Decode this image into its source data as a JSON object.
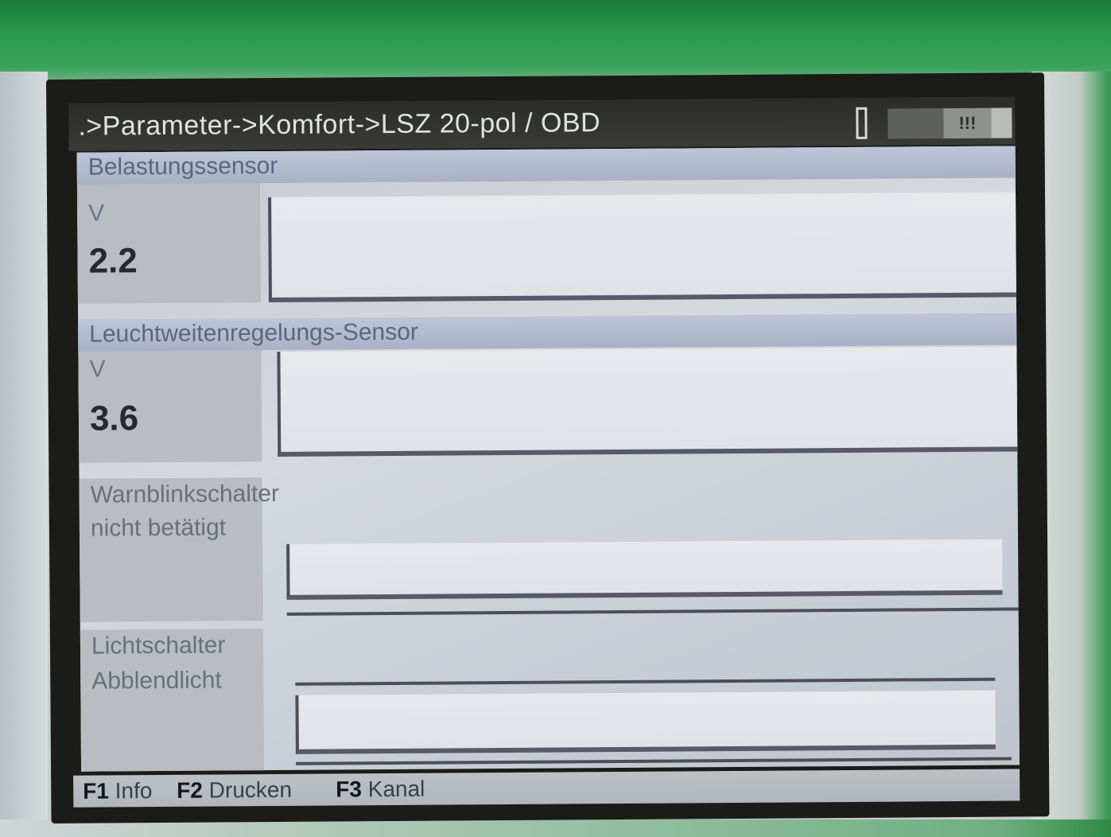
{
  "window": {
    "title": ".>Parameter->Komfort->LSZ 20-pol / OBD",
    "status_box": "!!!"
  },
  "panels": [
    {
      "title": "Belastungssensor",
      "unit": "V",
      "value": "2.2"
    },
    {
      "title": "Leuchtweitenregelungs-Sensor",
      "unit": "V",
      "value": "3.6"
    },
    {
      "title": "Warnblinkschalter",
      "state": "nicht betätigt"
    },
    {
      "title": "Lichtschalter",
      "state": "Abblendlicht"
    }
  ],
  "footer": {
    "keys": [
      {
        "key": "F1",
        "label": "Info"
      },
      {
        "key": "F2",
        "label": "Drucken"
      },
      {
        "key": "F3",
        "label": "Kanal"
      }
    ]
  },
  "colors": {
    "device_green": "#2a9a4c",
    "screen_background": "#c9cfd6",
    "title_bar": "#2b2c28"
  }
}
